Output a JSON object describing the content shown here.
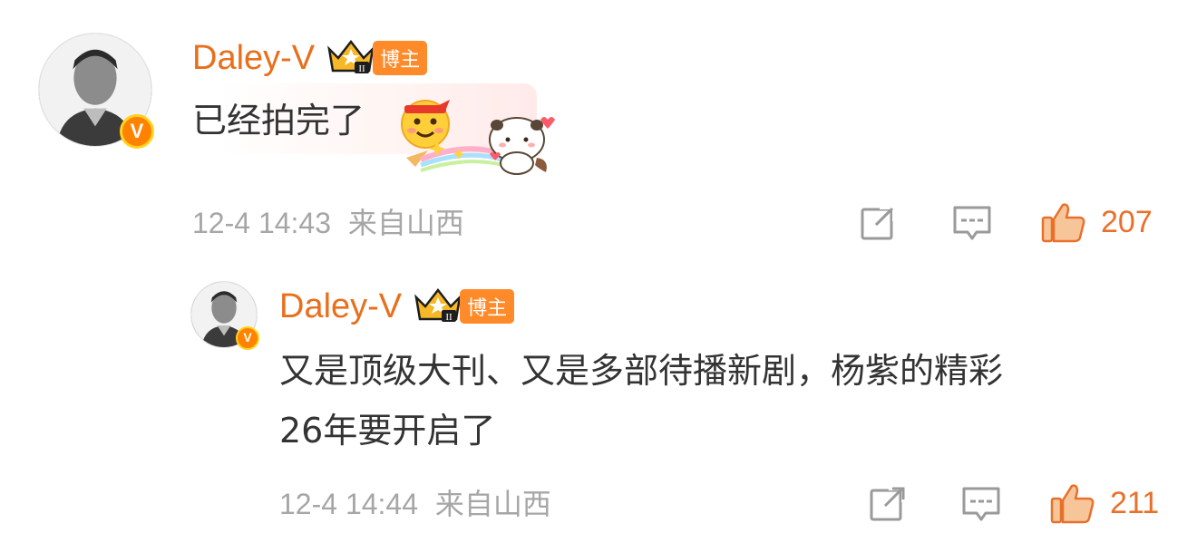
{
  "comments": [
    {
      "username": "Daley-V",
      "badge_label": "博主",
      "text": "已经拍完了",
      "timestamp": "12-4 14:43",
      "location": "来自山西",
      "likes": "207",
      "verified_badge": "V"
    },
    {
      "username": "Daley-V",
      "badge_label": "博主",
      "text_line1": "又是顶级大刊、又是多部待播新剧，杨紫的精彩",
      "text_line2": "26年要开启了",
      "timestamp": "12-4 14:44",
      "location": "来自山西",
      "likes": "211",
      "verified_badge": "V"
    }
  ],
  "icons": {
    "share": "share-icon",
    "comment": "comment-icon",
    "like": "thumbs-up-icon",
    "crown": "crown-badge-icon",
    "emoji": "emoji-headband-icon",
    "sticker": "panda-sticker-icon"
  },
  "colors": {
    "username": "#e86f1c",
    "badge_bg": "#ff8a2a",
    "like_accent": "#e8702a",
    "meta_text": "#a6a6a6",
    "body_text": "#333333"
  }
}
